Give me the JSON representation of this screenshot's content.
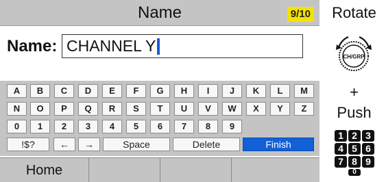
{
  "title": "Name",
  "counter": "9/10",
  "name_label": "Name:",
  "name_value": "CHANNEL Y",
  "keyboard": {
    "row1": [
      "A",
      "B",
      "C",
      "D",
      "E",
      "F",
      "G",
      "H",
      "I",
      "J",
      "K",
      "L",
      "M"
    ],
    "row2": [
      "N",
      "O",
      "P",
      "Q",
      "R",
      "S",
      "T",
      "U",
      "V",
      "W",
      "X",
      "Y",
      "Z"
    ],
    "row3": [
      "0",
      "1",
      "2",
      "3",
      "4",
      "5",
      "6",
      "7",
      "8",
      "9"
    ],
    "symbols": "!$?",
    "left_arrow": "←",
    "right_arrow": "→",
    "space": "Space",
    "delete": "Delete",
    "finish": "Finish"
  },
  "softkeys": [
    "Home",
    "",
    "",
    "",
    ""
  ],
  "side": {
    "rotate": "Rotate",
    "knob_label": "CH/GRP",
    "plus": "+",
    "push": "Push",
    "digits": [
      "1",
      "2",
      "3",
      "4",
      "5",
      "6",
      "7",
      "8",
      "9",
      "0"
    ]
  },
  "colors": {
    "counter_bg": "#f4e200",
    "finish_bg": "#1260d8",
    "cursor": "#1a5bd8",
    "panel_gray": "#c4c4c4"
  },
  "icons": {
    "knob": "rotary-knob-icon",
    "rotate_left": "rotate-left-arrow-icon",
    "rotate_right": "rotate-right-arrow-icon"
  }
}
